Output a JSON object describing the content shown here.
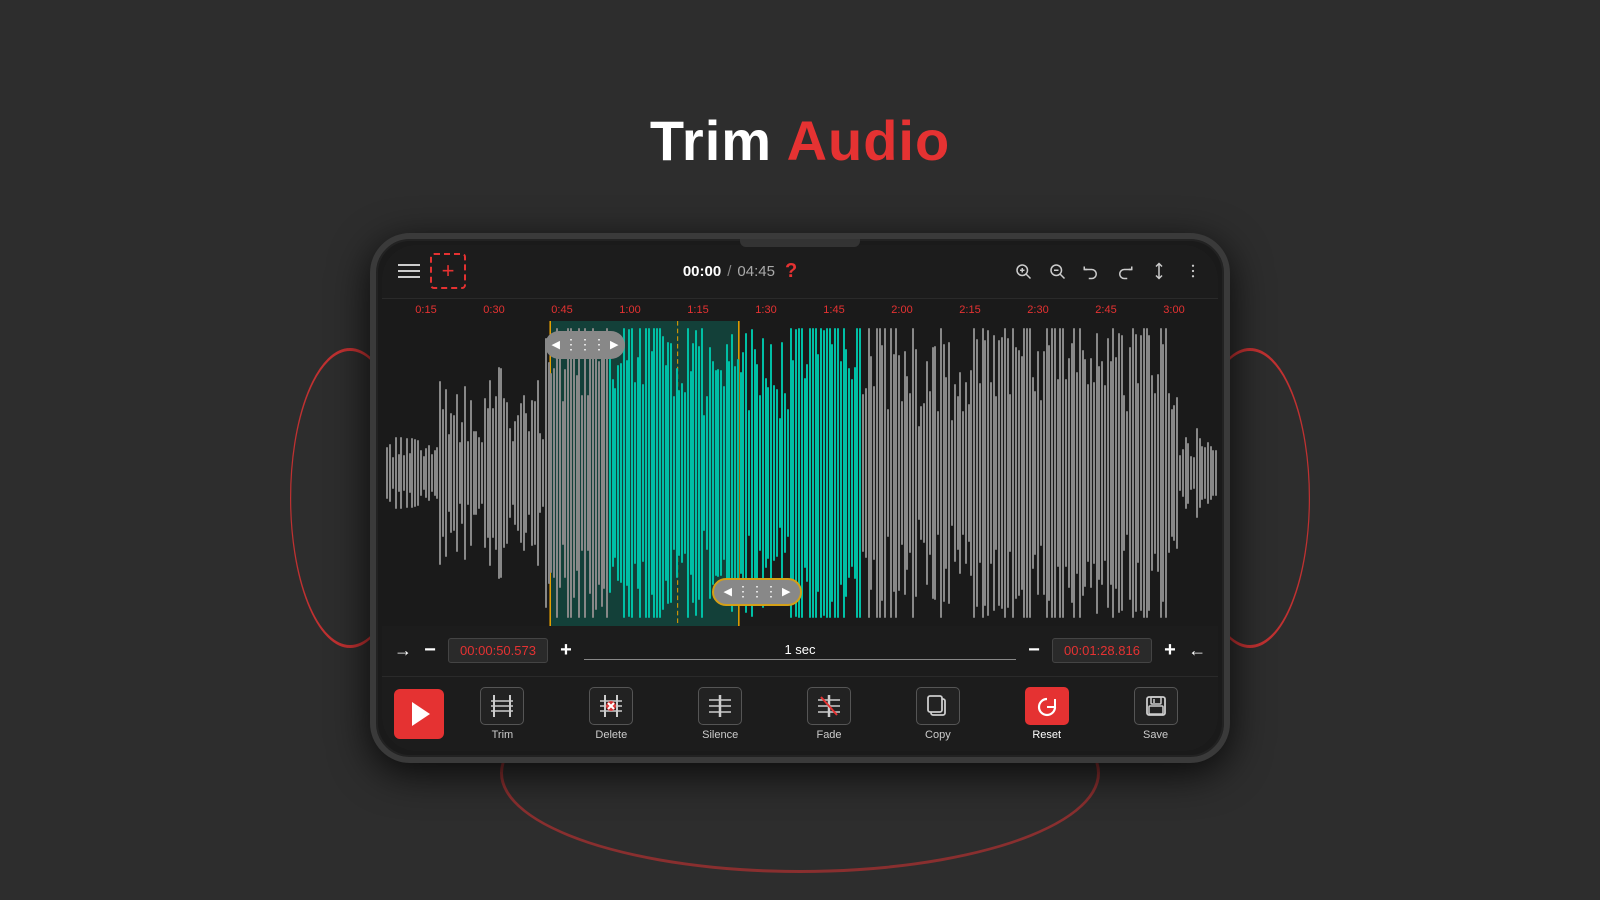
{
  "title": {
    "trim_word": "Trim",
    "audio_word": "Audio"
  },
  "toolbar": {
    "time_current": "00:00",
    "time_separator": "/",
    "time_total": "04:45",
    "help_icon": "?",
    "zoom_in_icon": "zoom-in",
    "zoom_out_icon": "zoom-out",
    "undo_icon": "undo",
    "redo_icon": "redo",
    "sort_icon": "sort",
    "more_icon": "more"
  },
  "ruler": {
    "marks": [
      "0:15",
      "0:30",
      "0:45",
      "1:00",
      "1:15",
      "1:30",
      "1:45",
      "2:00",
      "2:15",
      "2:30",
      "2:45",
      "3:00"
    ]
  },
  "bottom_controls": {
    "left_time": "00:00:50.573",
    "right_time": "00:01:28.816",
    "step_label": "1 sec"
  },
  "actions": [
    {
      "id": "trim",
      "label": "Trim",
      "icon": "trim"
    },
    {
      "id": "delete",
      "label": "Delete",
      "icon": "delete"
    },
    {
      "id": "silence",
      "label": "Silence",
      "icon": "silence"
    },
    {
      "id": "fade",
      "label": "Fade",
      "icon": "fade"
    },
    {
      "id": "copy",
      "label": "Copy",
      "icon": "copy"
    },
    {
      "id": "reset",
      "label": "Reset",
      "icon": "reset",
      "active": true
    },
    {
      "id": "save",
      "label": "Save",
      "icon": "save"
    }
  ]
}
